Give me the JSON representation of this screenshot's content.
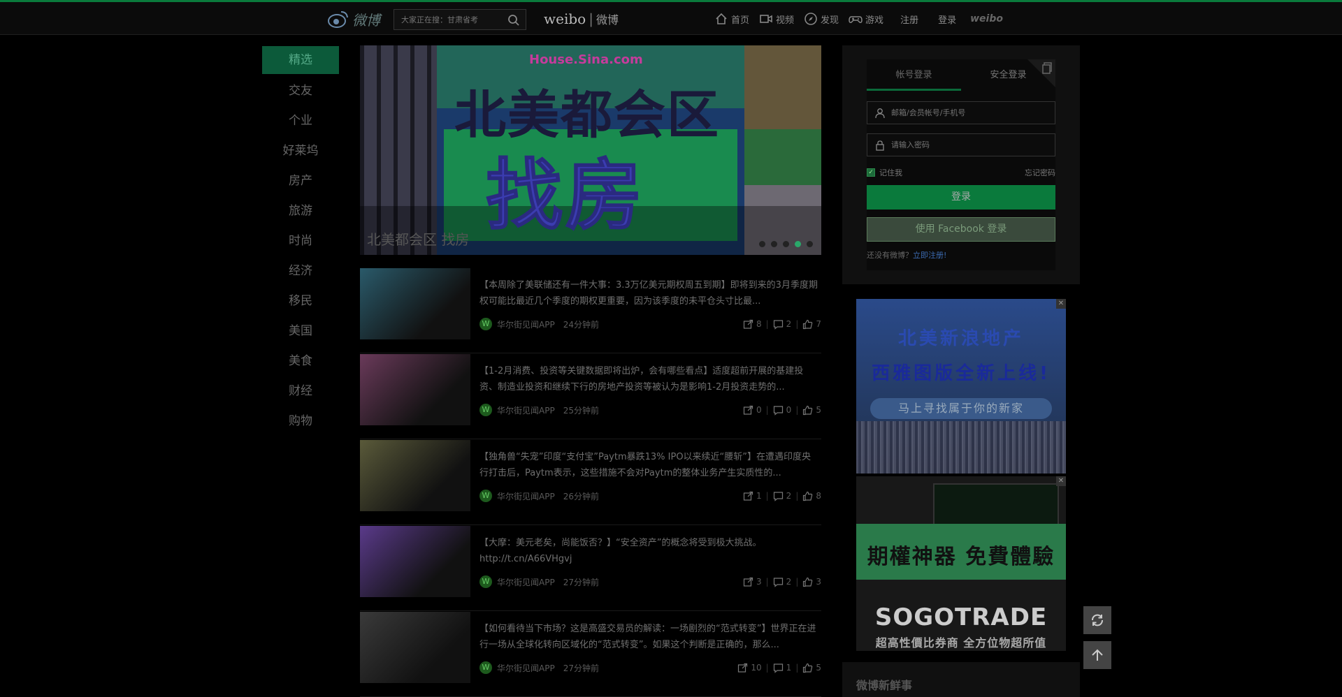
{
  "header": {
    "logo_text": "微博",
    "search_placeholder": "大家正在搜：甘肃省考",
    "brand_latin": "weibo",
    "brand_sep": "|",
    "brand_cn": "微博",
    "nav": [
      {
        "label": "首页",
        "icon": "home-icon"
      },
      {
        "label": "视频",
        "icon": "video-icon"
      },
      {
        "label": "发现",
        "icon": "compass-icon"
      },
      {
        "label": "游戏",
        "icon": "gamepad-icon"
      }
    ],
    "register": "注册",
    "login": "登录",
    "weibo_small": "weibo"
  },
  "leftnav": [
    "精选",
    "交友",
    "个业",
    "好莱坞",
    "房产",
    "旅游",
    "时尚",
    "经济",
    "移民",
    "美国",
    "美食",
    "财经",
    "购物"
  ],
  "banner": {
    "url": "House.Sina.com",
    "line1": "北美都会区",
    "line2": "找房",
    "caption": "北美都会区 找房",
    "dots": [
      false,
      false,
      false,
      true,
      false
    ]
  },
  "feed": [
    {
      "text": "【本周除了美联储还有一件大事：3.3万亿美元期权周五到期】即将到来的3月季度期权可能比最近几个季度的期权更重要，因为该季度的未平仓头寸比最...",
      "source": "华尔街见闻APP",
      "time": "24分钟前",
      "shares": "8",
      "comments": "2",
      "likes": "7",
      "thumb_color": "#2a5a6a"
    },
    {
      "text": "【1-2月消费、投资等关键数据即将出炉，会有哪些看点】适度超前开展的基建投资、制造业投资和继续下行的房地产投资等被认为是影响1-2月投资走势的...",
      "source": "华尔街见闻APP",
      "time": "25分钟前",
      "shares": "0",
      "comments": "0",
      "likes": "5",
      "thumb_color": "#6a3a5a"
    },
    {
      "text": "【独角兽“失宠”印度“支付宝”Paytm暴跌13% IPO以来续近“腰斩”】在遭遇印度央行打击后，Paytm表示，这些措施不会对Paytm的整体业务产生实质性的...",
      "source": "华尔街见闻APP",
      "time": "26分钟前",
      "shares": "1",
      "comments": "2",
      "likes": "8",
      "thumb_color": "#5a5a3a"
    },
    {
      "text": "【大摩：美元老矣，尚能饭否？】“安全资产”的概念将受到极大挑战。http://t.cn/A66VHgvj",
      "source": "华尔街见闻APP",
      "time": "27分钟前",
      "shares": "3",
      "comments": "2",
      "likes": "3",
      "thumb_color": "#5a3a8a"
    },
    {
      "text": "【如何看待当下市场？这是高盛交易员的解读：一场剧烈的“范式转变”】世界正在进行一场从全球化转向区域化的“范式转变”。如果这个判断是正确的，那么...",
      "source": "华尔街见闻APP",
      "time": "27分钟前",
      "shares": "10",
      "comments": "1",
      "likes": "5",
      "thumb_color": "#3a3a3a"
    }
  ],
  "login": {
    "tab_account": "帐号登录",
    "tab_secure": "安全登录",
    "user_placeholder": "邮箱/会员帐号/手机号",
    "pass_placeholder": "请输入密码",
    "remember": "记住我",
    "forgot": "忘记密码",
    "login_btn": "登录",
    "fb_btn": "使用 Facebook 登录",
    "signup_prefix": "还没有微博？",
    "signup_link": "立即注册!"
  },
  "ads": {
    "ad1_line1": "北美新浪地产",
    "ad1_line2": "西雅图版全新上线!",
    "ad1_line3": "马上寻找属于你的新家",
    "ad2_band": "期權神器 免費體驗",
    "ad2_brand": "SOGOTRADE",
    "ad2_tag": "超高性價比券商 全方位物超所值",
    "close": "✕"
  },
  "fresh_title": "微博新鲜事"
}
